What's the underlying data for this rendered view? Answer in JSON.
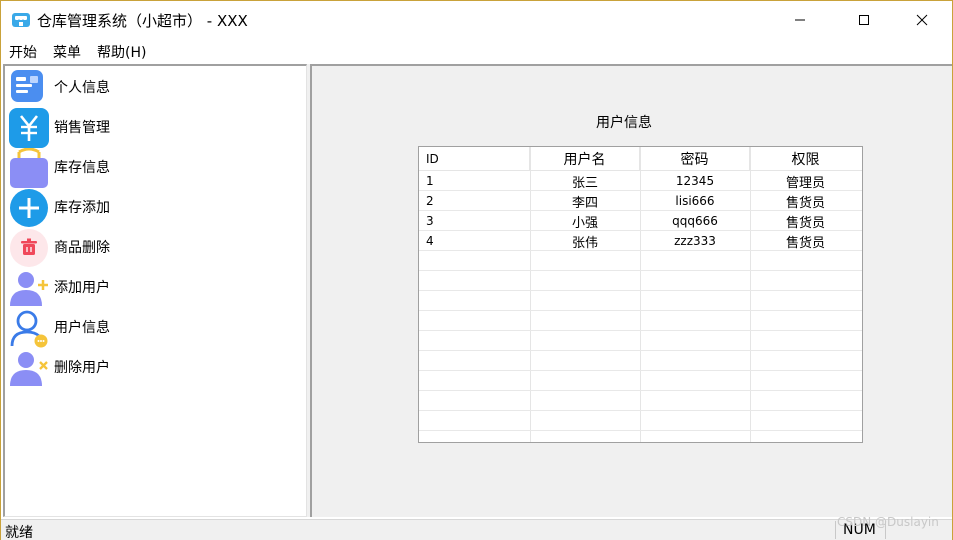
{
  "window": {
    "title": "仓库管理系统（小超市） - XXX"
  },
  "menubar": {
    "items": [
      {
        "label": "开始"
      },
      {
        "label": "菜单"
      },
      {
        "label": "帮助(H)"
      }
    ]
  },
  "nav": {
    "items": [
      {
        "label": "个人信息",
        "icon": "id-card-icon"
      },
      {
        "label": "销售管理",
        "icon": "yen-icon"
      },
      {
        "label": "库存信息",
        "icon": "shopping-bag-icon"
      },
      {
        "label": "库存添加",
        "icon": "plus-circle-icon"
      },
      {
        "label": "商品删除",
        "icon": "trash-icon"
      },
      {
        "label": "添加用户",
        "icon": "add-user-icon"
      },
      {
        "label": "用户信息",
        "icon": "user-info-icon"
      },
      {
        "label": "删除用户",
        "icon": "delete-user-icon"
      }
    ]
  },
  "form": {
    "title": "用户信息"
  },
  "table": {
    "columns": [
      "ID",
      "用户名",
      "密码",
      "权限"
    ],
    "rows": [
      [
        "1",
        "张三",
        "12345",
        "管理员"
      ],
      [
        "2",
        "李四",
        "lisi666",
        "售货员"
      ],
      [
        "3",
        "小强",
        "qqq666",
        "售货员"
      ],
      [
        "4",
        "张伟",
        "zzz333",
        "售货员"
      ]
    ]
  },
  "statusbar": {
    "text": "就绪",
    "num": "NUM"
  },
  "watermark": "CSDN @Duslayin",
  "colors": {
    "accent_blue": "#2f8cf0",
    "icon_purple": "#8b8ef5",
    "icon_red": "#f0485a",
    "icon_yellow": "#f5c43a"
  }
}
